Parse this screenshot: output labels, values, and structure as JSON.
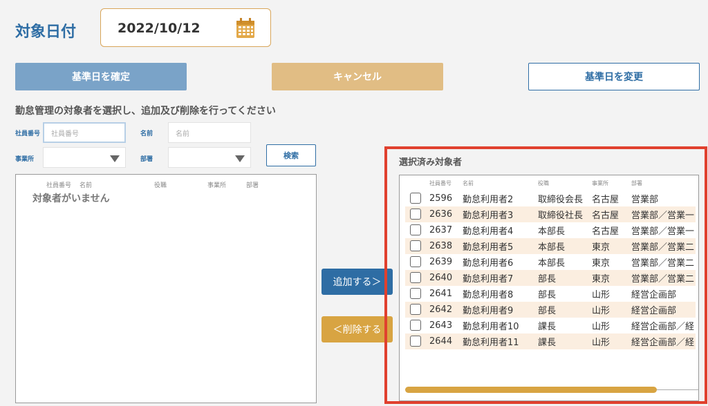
{
  "header": {
    "target_date_label": "対象日付",
    "date_value": "2022/10/12"
  },
  "buttons": {
    "confirm": "基準日を確定",
    "cancel": "キャンセル",
    "change": "基準日を変更",
    "search": "検索",
    "add": "追加する＞",
    "delete": "＜削除する"
  },
  "instructions": "勤怠管理の対象者を選択し、追加及び削除を行ってください",
  "filters": {
    "employee_no_label": "社員番号",
    "employee_no_placeholder": "社員番号",
    "name_label": "名前",
    "name_placeholder": "名前",
    "office_label": "事業所",
    "dept_label": "部署"
  },
  "left_table": {
    "columns": [
      "社員番号",
      "名前",
      "役職",
      "事業所",
      "部署"
    ],
    "empty_message": "対象者がいません"
  },
  "right_table": {
    "title": "選択済み対象者",
    "columns": [
      "社員番号",
      "名前",
      "役職",
      "事業所",
      "部署"
    ],
    "rows": [
      {
        "id": "2596",
        "name": "勤怠利用者2",
        "role": "取締役会長",
        "office": "名古屋",
        "dept": "営業部"
      },
      {
        "id": "2636",
        "name": "勤怠利用者3",
        "role": "取締役社長",
        "office": "名古屋",
        "dept": "営業部／営業一"
      },
      {
        "id": "2637",
        "name": "勤怠利用者4",
        "role": "本部長",
        "office": "名古屋",
        "dept": "営業部／営業一"
      },
      {
        "id": "2638",
        "name": "勤怠利用者5",
        "role": "本部長",
        "office": "東京",
        "dept": "営業部／営業二"
      },
      {
        "id": "2639",
        "name": "勤怠利用者6",
        "role": "本部長",
        "office": "東京",
        "dept": "営業部／営業二"
      },
      {
        "id": "2640",
        "name": "勤怠利用者7",
        "role": "部長",
        "office": "東京",
        "dept": "営業部／営業二"
      },
      {
        "id": "2641",
        "name": "勤怠利用者8",
        "role": "部長",
        "office": "山形",
        "dept": "経営企画部"
      },
      {
        "id": "2642",
        "name": "勤怠利用者9",
        "role": "部長",
        "office": "山形",
        "dept": "経営企画部"
      },
      {
        "id": "2643",
        "name": "勤怠利用者10",
        "role": "課長",
        "office": "山形",
        "dept": "経営企画部／経"
      },
      {
        "id": "2644",
        "name": "勤怠利用者11",
        "role": "課長",
        "office": "山形",
        "dept": "経営企画部／経"
      }
    ]
  },
  "colors": {
    "primary_blue": "#2e6da4",
    "gold": "#d8a442",
    "highlight_red": "#e0402e",
    "row_alt": "#fbeee0"
  },
  "icons": {
    "date": "calendar-icon",
    "select": "chevron-down-icon"
  }
}
